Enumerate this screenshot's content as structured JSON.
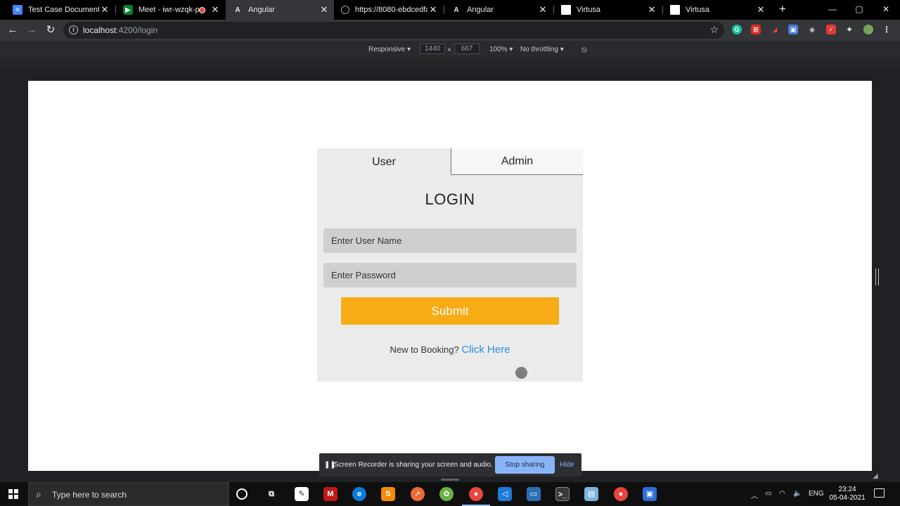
{
  "browser": {
    "tabs": [
      {
        "title": "Test Case Document - (",
        "favicon": "docs-icon",
        "active": false
      },
      {
        "title": "Meet - iwr-wzqk-p",
        "favicon": "meet-icon",
        "active": false,
        "recording": true
      },
      {
        "title": "Angular",
        "favicon": "angular-icon",
        "active": true
      },
      {
        "title": "https://8080-ebdcedfa",
        "favicon": "globe-icon",
        "active": false
      },
      {
        "title": "Angular",
        "favicon": "angular-icon",
        "active": false
      },
      {
        "title": "Virtusa",
        "favicon": "virtusa-icon",
        "active": false
      },
      {
        "title": "Virtusa",
        "favicon": "virtusa-icon",
        "active": false
      }
    ],
    "new_tab": "+",
    "window_controls": {
      "minimize": "—",
      "maximize": "▢",
      "close": "✕"
    },
    "url_host": "localhost",
    "url_path": ":4200/login"
  },
  "devtools": {
    "device": "Responsive ▾",
    "width": "1440",
    "times": "×",
    "height": "667",
    "zoom": "100% ▾",
    "throttling": "No throttling ▾"
  },
  "login_card": {
    "tab_user": "User",
    "tab_admin": "Admin",
    "title": "LOGIN",
    "username_placeholder": "Enter User Name",
    "password_placeholder": "Enter Password",
    "submit_label": "Submit",
    "signup_prompt": "New to Booking?",
    "signup_link": "Click Here",
    "colors": {
      "submit": "#f7ab14",
      "link": "#2a8ee0",
      "card": "#ebebeb"
    }
  },
  "recorder": {
    "message": "Screen Recorder is sharing your screen and audio.",
    "stop_label": "Stop sharing",
    "hide_label": "Hide"
  },
  "taskbar": {
    "search_placeholder": "Type here to search",
    "language": "ENG",
    "time": "23:24",
    "date": "05-04-2021"
  }
}
